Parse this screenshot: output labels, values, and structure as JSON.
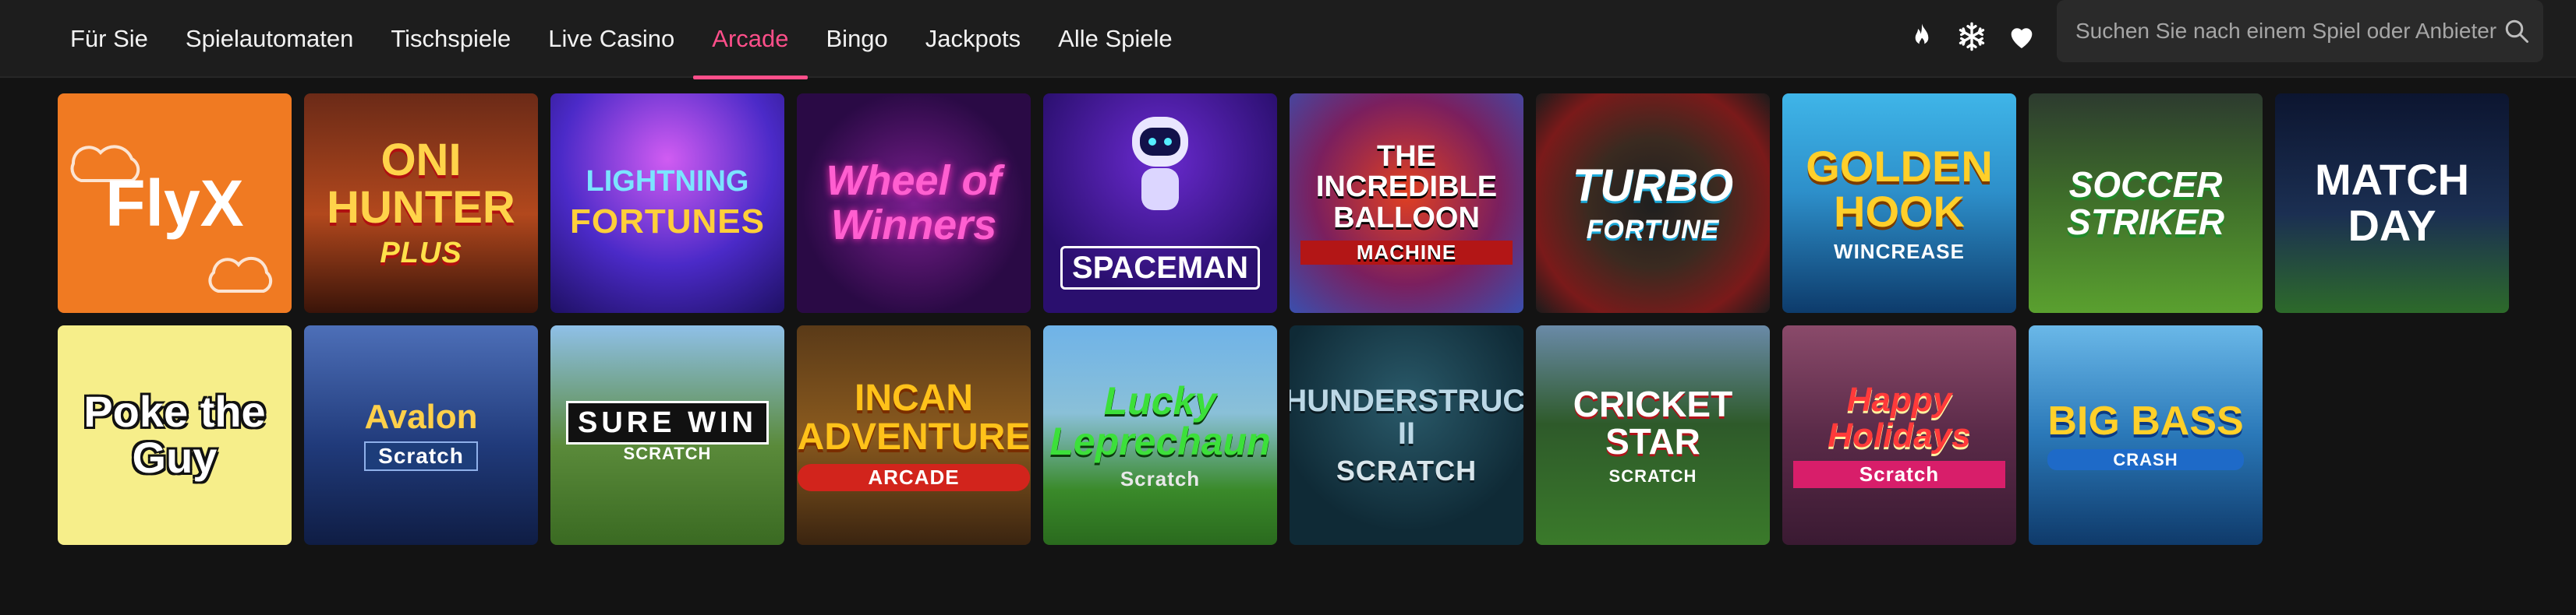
{
  "nav": {
    "items": [
      {
        "label": "Für Sie",
        "active": false
      },
      {
        "label": "Spielautomaten",
        "active": false
      },
      {
        "label": "Tischspiele",
        "active": false
      },
      {
        "label": "Live Casino",
        "active": false
      },
      {
        "label": "Arcade",
        "active": true
      },
      {
        "label": "Bingo",
        "active": false
      },
      {
        "label": "Jackpots",
        "active": false
      },
      {
        "label": "Alle Spiele",
        "active": false
      }
    ],
    "accent_color": "#ff4f8a"
  },
  "toolbar": {
    "icons": [
      "fire-icon",
      "snowflake-icon",
      "heart-icon"
    ]
  },
  "search": {
    "placeholder": "Suchen Sie nach einem Spiel oder Anbieter"
  },
  "games": {
    "row1": [
      {
        "title": "FlyX",
        "sub": ""
      },
      {
        "title": "Oni Hunter",
        "sub": "Plus"
      },
      {
        "title": "Lightning",
        "sub": "Fortunes"
      },
      {
        "title": "Wheel of Winners",
        "sub": ""
      },
      {
        "title": "Spaceman",
        "sub": ""
      },
      {
        "title": "The Incredible Balloon",
        "sub": "Machine"
      },
      {
        "title": "Turbo",
        "sub": "Fortune"
      },
      {
        "title": "Golden Hook",
        "sub": "Wincrease"
      },
      {
        "title": "Soccer Striker",
        "sub": ""
      },
      {
        "title": "Match Day",
        "sub": ""
      }
    ],
    "row2": [
      {
        "title": "Poke the Guy",
        "sub": ""
      },
      {
        "title": "Avalon",
        "sub": "Scratch"
      },
      {
        "title": "Sure Win",
        "sub": "Scratch"
      },
      {
        "title": "Incan Adventure",
        "sub": "Arcade"
      },
      {
        "title": "Lucky Leprechaun",
        "sub": "Scratch"
      },
      {
        "title": "Thunderstruck II",
        "sub": "Scratch"
      },
      {
        "title": "Cricket Star",
        "sub": "Scratch"
      },
      {
        "title": "Happy Holidays",
        "sub": "Scratch"
      },
      {
        "title": "Big Bass",
        "sub": "Crash"
      }
    ]
  }
}
